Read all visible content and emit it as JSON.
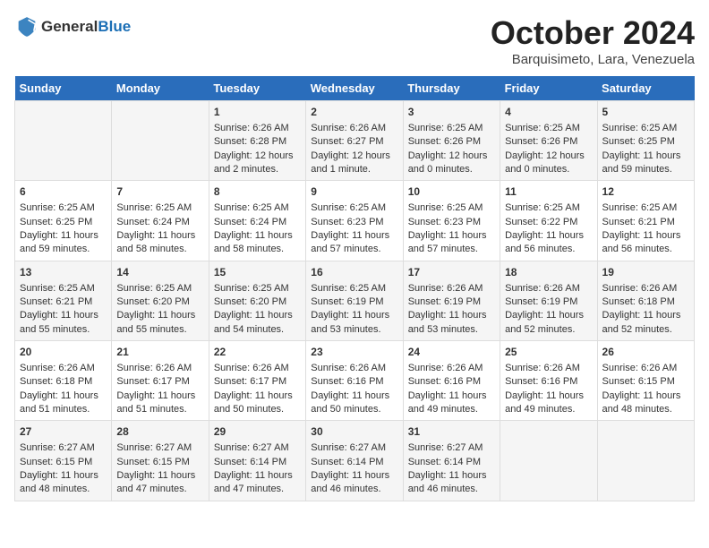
{
  "header": {
    "logo_general": "General",
    "logo_blue": "Blue",
    "month_title": "October 2024",
    "location": "Barquisimeto, Lara, Venezuela"
  },
  "days_of_week": [
    "Sunday",
    "Monday",
    "Tuesday",
    "Wednesday",
    "Thursday",
    "Friday",
    "Saturday"
  ],
  "weeks": [
    [
      {
        "day": "",
        "content": ""
      },
      {
        "day": "",
        "content": ""
      },
      {
        "day": "1",
        "content": "Sunrise: 6:26 AM\nSunset: 6:28 PM\nDaylight: 12 hours and 2 minutes."
      },
      {
        "day": "2",
        "content": "Sunrise: 6:26 AM\nSunset: 6:27 PM\nDaylight: 12 hours and 1 minute."
      },
      {
        "day": "3",
        "content": "Sunrise: 6:25 AM\nSunset: 6:26 PM\nDaylight: 12 hours and 0 minutes."
      },
      {
        "day": "4",
        "content": "Sunrise: 6:25 AM\nSunset: 6:26 PM\nDaylight: 12 hours and 0 minutes."
      },
      {
        "day": "5",
        "content": "Sunrise: 6:25 AM\nSunset: 6:25 PM\nDaylight: 11 hours and 59 minutes."
      }
    ],
    [
      {
        "day": "6",
        "content": "Sunrise: 6:25 AM\nSunset: 6:25 PM\nDaylight: 11 hours and 59 minutes."
      },
      {
        "day": "7",
        "content": "Sunrise: 6:25 AM\nSunset: 6:24 PM\nDaylight: 11 hours and 58 minutes."
      },
      {
        "day": "8",
        "content": "Sunrise: 6:25 AM\nSunset: 6:24 PM\nDaylight: 11 hours and 58 minutes."
      },
      {
        "day": "9",
        "content": "Sunrise: 6:25 AM\nSunset: 6:23 PM\nDaylight: 11 hours and 57 minutes."
      },
      {
        "day": "10",
        "content": "Sunrise: 6:25 AM\nSunset: 6:23 PM\nDaylight: 11 hours and 57 minutes."
      },
      {
        "day": "11",
        "content": "Sunrise: 6:25 AM\nSunset: 6:22 PM\nDaylight: 11 hours and 56 minutes."
      },
      {
        "day": "12",
        "content": "Sunrise: 6:25 AM\nSunset: 6:21 PM\nDaylight: 11 hours and 56 minutes."
      }
    ],
    [
      {
        "day": "13",
        "content": "Sunrise: 6:25 AM\nSunset: 6:21 PM\nDaylight: 11 hours and 55 minutes."
      },
      {
        "day": "14",
        "content": "Sunrise: 6:25 AM\nSunset: 6:20 PM\nDaylight: 11 hours and 55 minutes."
      },
      {
        "day": "15",
        "content": "Sunrise: 6:25 AM\nSunset: 6:20 PM\nDaylight: 11 hours and 54 minutes."
      },
      {
        "day": "16",
        "content": "Sunrise: 6:25 AM\nSunset: 6:19 PM\nDaylight: 11 hours and 53 minutes."
      },
      {
        "day": "17",
        "content": "Sunrise: 6:26 AM\nSunset: 6:19 PM\nDaylight: 11 hours and 53 minutes."
      },
      {
        "day": "18",
        "content": "Sunrise: 6:26 AM\nSunset: 6:19 PM\nDaylight: 11 hours and 52 minutes."
      },
      {
        "day": "19",
        "content": "Sunrise: 6:26 AM\nSunset: 6:18 PM\nDaylight: 11 hours and 52 minutes."
      }
    ],
    [
      {
        "day": "20",
        "content": "Sunrise: 6:26 AM\nSunset: 6:18 PM\nDaylight: 11 hours and 51 minutes."
      },
      {
        "day": "21",
        "content": "Sunrise: 6:26 AM\nSunset: 6:17 PM\nDaylight: 11 hours and 51 minutes."
      },
      {
        "day": "22",
        "content": "Sunrise: 6:26 AM\nSunset: 6:17 PM\nDaylight: 11 hours and 50 minutes."
      },
      {
        "day": "23",
        "content": "Sunrise: 6:26 AM\nSunset: 6:16 PM\nDaylight: 11 hours and 50 minutes."
      },
      {
        "day": "24",
        "content": "Sunrise: 6:26 AM\nSunset: 6:16 PM\nDaylight: 11 hours and 49 minutes."
      },
      {
        "day": "25",
        "content": "Sunrise: 6:26 AM\nSunset: 6:16 PM\nDaylight: 11 hours and 49 minutes."
      },
      {
        "day": "26",
        "content": "Sunrise: 6:26 AM\nSunset: 6:15 PM\nDaylight: 11 hours and 48 minutes."
      }
    ],
    [
      {
        "day": "27",
        "content": "Sunrise: 6:27 AM\nSunset: 6:15 PM\nDaylight: 11 hours and 48 minutes."
      },
      {
        "day": "28",
        "content": "Sunrise: 6:27 AM\nSunset: 6:15 PM\nDaylight: 11 hours and 47 minutes."
      },
      {
        "day": "29",
        "content": "Sunrise: 6:27 AM\nSunset: 6:14 PM\nDaylight: 11 hours and 47 minutes."
      },
      {
        "day": "30",
        "content": "Sunrise: 6:27 AM\nSunset: 6:14 PM\nDaylight: 11 hours and 46 minutes."
      },
      {
        "day": "31",
        "content": "Sunrise: 6:27 AM\nSunset: 6:14 PM\nDaylight: 11 hours and 46 minutes."
      },
      {
        "day": "",
        "content": ""
      },
      {
        "day": "",
        "content": ""
      }
    ]
  ]
}
